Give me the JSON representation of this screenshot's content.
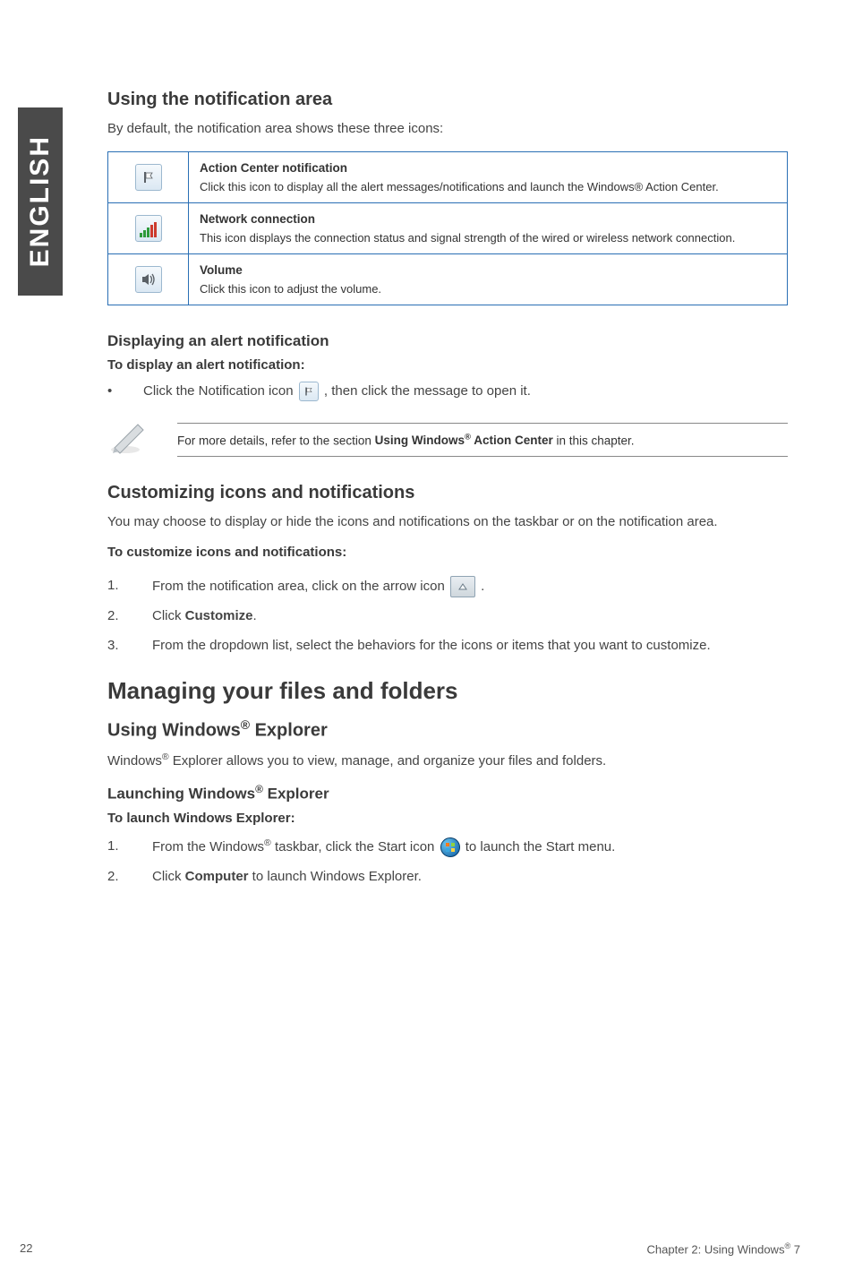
{
  "side_tab": {
    "label": "ENGLISH"
  },
  "section_notif_area": {
    "heading": "Using the notification area",
    "intro": "By default, the notification area shows these three icons:"
  },
  "icon_table": {
    "rows": [
      {
        "icon_name": "action-center-icon",
        "title": "Action Center notification",
        "desc": "Click this icon to display all the alert messages/notifications and launch the Windows® Action Center."
      },
      {
        "icon_name": "network-icon",
        "title": "Network connection",
        "desc": "This icon displays the connection status and signal strength of the wired or wireless network connection."
      },
      {
        "icon_name": "volume-icon",
        "title": "Volume",
        "desc": "Click this icon to adjust the volume."
      }
    ]
  },
  "alert_section": {
    "heading": "Displaying an alert notification",
    "subheading": "To display an alert notification:",
    "bullet_pre": "Click the Notification icon ",
    "bullet_post": ", then click the message to open it."
  },
  "note": {
    "text_pre": "For more details, refer to the section ",
    "bold1": "Using Windows",
    "sup1": "®",
    "bold2": " Action Center",
    "text_post": " in this chapter."
  },
  "customize_section": {
    "heading": "Customizing icons and notifications",
    "intro": "You may choose to display or hide the icons and notifications on the taskbar or on the notification area.",
    "subheading": "To customize icons and notifications:",
    "steps": [
      {
        "num": "1.",
        "pre": "From the notification area, click on the arrow icon ",
        "post": "."
      },
      {
        "num": "2.",
        "pre": "Click ",
        "bold": "Customize",
        "post": "."
      },
      {
        "num": "3.",
        "pre": "From the dropdown list, select the behaviors for the icons or items that you want to customize.",
        "post": ""
      }
    ]
  },
  "managing_section": {
    "heading": "Managing your files and folders",
    "sub1": {
      "heading_pre": "Using Windows",
      "heading_sup": "®",
      "heading_post": " Explorer",
      "intro_pre": "Windows",
      "intro_sup": "®",
      "intro_post": " Explorer allows you to view, manage, and organize your files and folders."
    },
    "sub2": {
      "heading_pre": "Launching Windows",
      "heading_sup": "®",
      "heading_post": " Explorer",
      "subheading": "To launch Windows Explorer:",
      "steps": [
        {
          "num": "1.",
          "pre1": "From the Windows",
          "sup": "®",
          "pre2": " taskbar, click the Start icon ",
          "post": " to launch the Start menu."
        },
        {
          "num": "2.",
          "pre": "Click ",
          "bold": "Computer",
          "post": " to launch Windows Explorer."
        }
      ]
    }
  },
  "footer": {
    "page_num": "22",
    "right_pre": "Chapter 2: Using Windows",
    "right_sup": "®",
    "right_post": " 7"
  }
}
